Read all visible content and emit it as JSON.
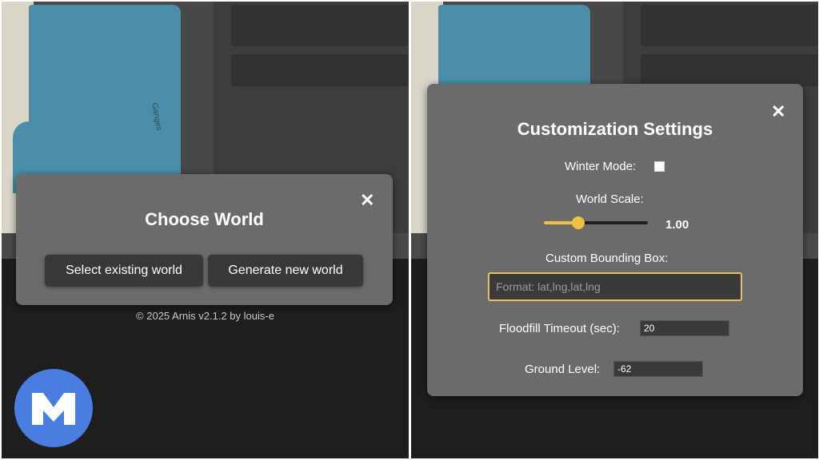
{
  "left": {
    "map": {
      "river_label": "Ganges"
    },
    "dialog": {
      "title": "Choose World",
      "close_icon": "close-icon",
      "buttons": {
        "select_existing": "Select existing world",
        "generate_new": "Generate new world"
      }
    },
    "footer": {
      "copyright": "© 2025 Arnis v2.1.2 by louis-e"
    },
    "logo": {
      "icon": "arnis-logo"
    }
  },
  "right": {
    "dialog": {
      "title": "Customization Settings",
      "close_icon": "close-icon",
      "winter_mode": {
        "label": "Winter Mode:",
        "checked": false
      },
      "world_scale": {
        "label": "World Scale:",
        "value": "1.00",
        "fraction": 0.33
      },
      "bounding_box": {
        "label": "Custom Bounding Box:",
        "placeholder": "Format: lat,lng,lat,lng",
        "value": ""
      },
      "floodfill_timeout": {
        "label": "Floodfill Timeout (sec):",
        "value": "20"
      },
      "ground_level": {
        "label": "Ground Level:",
        "value": "-62"
      }
    }
  },
  "colors": {
    "accent": "#f0c040",
    "dialog_bg": "#6b6b6b",
    "button_bg": "#383838",
    "logo_blue": "#4a7de0"
  }
}
